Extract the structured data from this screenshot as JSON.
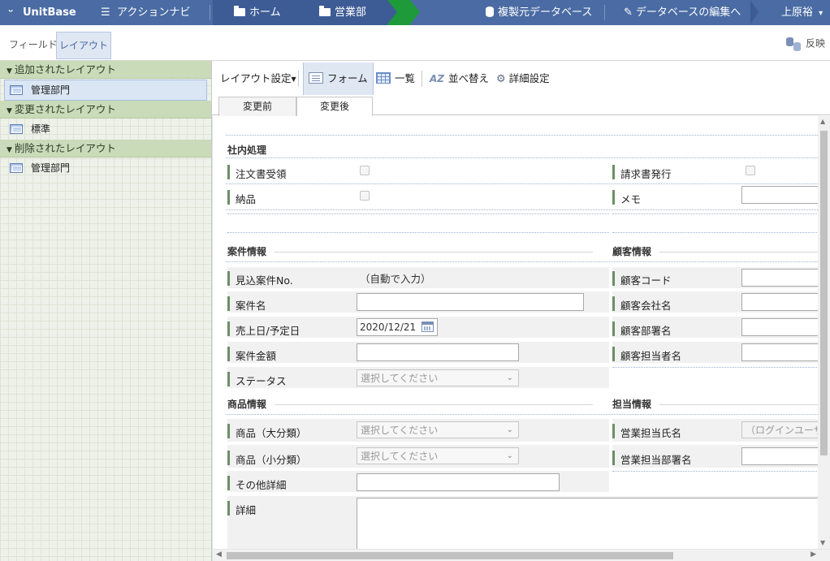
{
  "topnav": {
    "logo": "UnitBase",
    "action_navi": "アクションナビ",
    "breadcrumbs": [
      "ホーム",
      "営業部"
    ],
    "copy_source": "複製元データベース",
    "edit_database": "データベースの編集へ",
    "user": "上原裕",
    "user_caret": "▾"
  },
  "subnav": {
    "tabs": [
      "フィールド",
      "レイアウト"
    ],
    "active_tab": "レイアウト",
    "apply": "反映"
  },
  "sidebar": {
    "sections": [
      {
        "title": "追加されたレイアウト",
        "items": [
          "管理部門"
        ],
        "selected": 0
      },
      {
        "title": "変更されたレイアウト",
        "items": [
          "標準"
        ]
      },
      {
        "title": "削除されたレイアウト",
        "items": [
          "管理部門"
        ]
      }
    ]
  },
  "toolbar": {
    "layout_settings": "レイアウト設定",
    "form": "フォーム",
    "list": "一覧",
    "sort": "並べ替え",
    "detail_settings": "詳細設定",
    "sort_icon_text": "AZ"
  },
  "view_tabs": {
    "before": "変更前",
    "after": "変更後",
    "active": "after"
  },
  "form": {
    "sections": {
      "internal": "社内処理",
      "deal": "案件情報",
      "customer": "顧客情報",
      "product": "商品情報",
      "owner": "担当情報"
    },
    "labels": {
      "order_received": "注文書受領",
      "invoice_issued": "請求書発行",
      "delivered": "納品",
      "memo": "メモ",
      "deal_no": "見込案件No.",
      "deal_name": "案件名",
      "sales_date": "売上日/予定日",
      "amount": "案件金額",
      "status": "ステータス",
      "customer_code": "顧客コード",
      "customer_company": "顧客会社名",
      "customer_dept": "顧客部署名",
      "customer_person": "顧客担当者名",
      "product_major": "商品（大分類）",
      "product_minor": "商品（小分類）",
      "other_detail": "その他詳細",
      "detail": "詳細",
      "sales_person": "営業担当氏名",
      "sales_dept": "営業担当部署名"
    },
    "values": {
      "deal_no": "（自動で入力）",
      "sales_date": "2020/12/21",
      "select_placeholder": "選択してください",
      "sales_person": "（ログインユーザ"
    }
  }
}
